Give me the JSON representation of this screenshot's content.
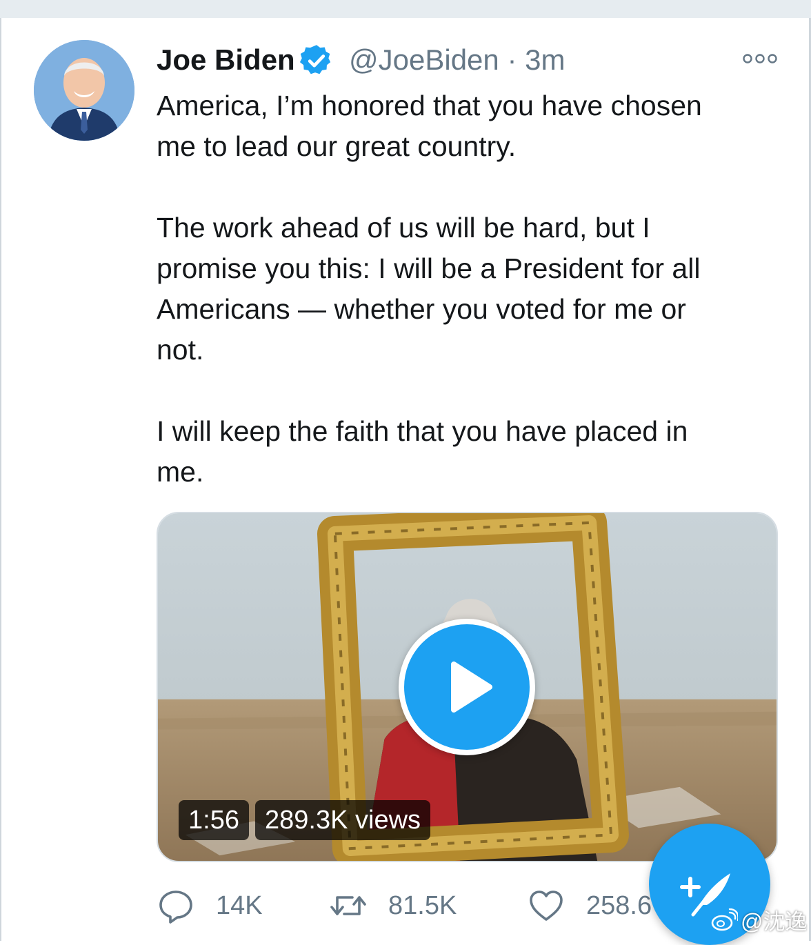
{
  "tweet": {
    "author_name": "Joe Biden",
    "handle": "@JoeBiden",
    "separator": "·",
    "time": "3m",
    "text": "America, I’m honored that you have chosen\nme to lead our great country.\n\nThe work ahead of us will be hard, but I\npromise you this: I will be a President for all\nAmericans — whether you voted for me or\nnot.\n\nI will keep the faith that you have placed in\nme."
  },
  "media": {
    "duration": "1:56",
    "views": "289.3K views"
  },
  "actions": {
    "replies": "14K",
    "retweets": "81.5K",
    "likes": "258.6"
  },
  "watermark": {
    "text": "@沈逸"
  },
  "icons": {
    "verified": "verified-badge-icon",
    "more": "more-options-icon",
    "play": "play-icon",
    "reply": "reply-icon",
    "retweet": "retweet-icon",
    "like": "heart-icon",
    "compose": "compose-tweet-icon",
    "weibo": "weibo-logo-icon"
  },
  "colors": {
    "accent": "#1da1f2",
    "secondary_text": "#657786",
    "primary_text": "#14171a"
  }
}
